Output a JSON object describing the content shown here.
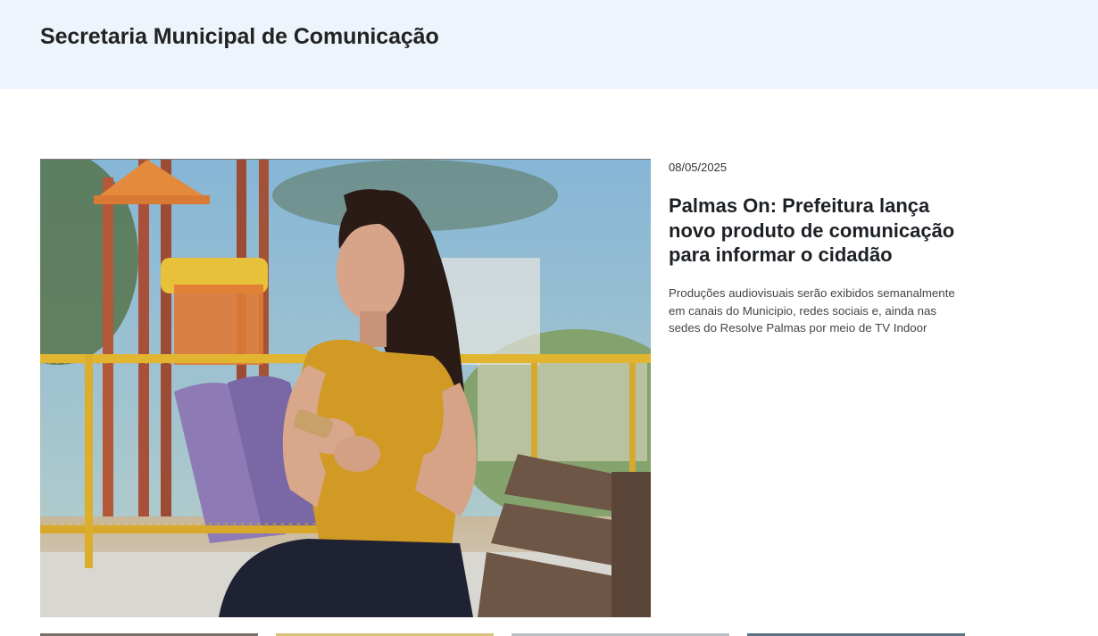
{
  "header": {
    "title": "Secretaria Municipal de Comunicação"
  },
  "featured_news": {
    "date": "08/05/2025",
    "headline": "Palmas On: Prefeitura lança novo produto de comunicação para informar o cidadão",
    "summary": "Produções audiovisuais serão exibidos semanalmente em canais do Municipio, redes sociais e, ainda nas sedes do Resolve Palmas por meio de TV Indoor",
    "image_icon": "photo-woman-smartphone-playground"
  },
  "more_news": {
    "thumbnail_colors": [
      "#7a6f66",
      "#d9c27a",
      "#b9c3c6",
      "#5d6f85"
    ]
  },
  "colors": {
    "header_background": "#edf4fc",
    "text_primary": "#1d2125",
    "text_secondary": "#444444"
  }
}
